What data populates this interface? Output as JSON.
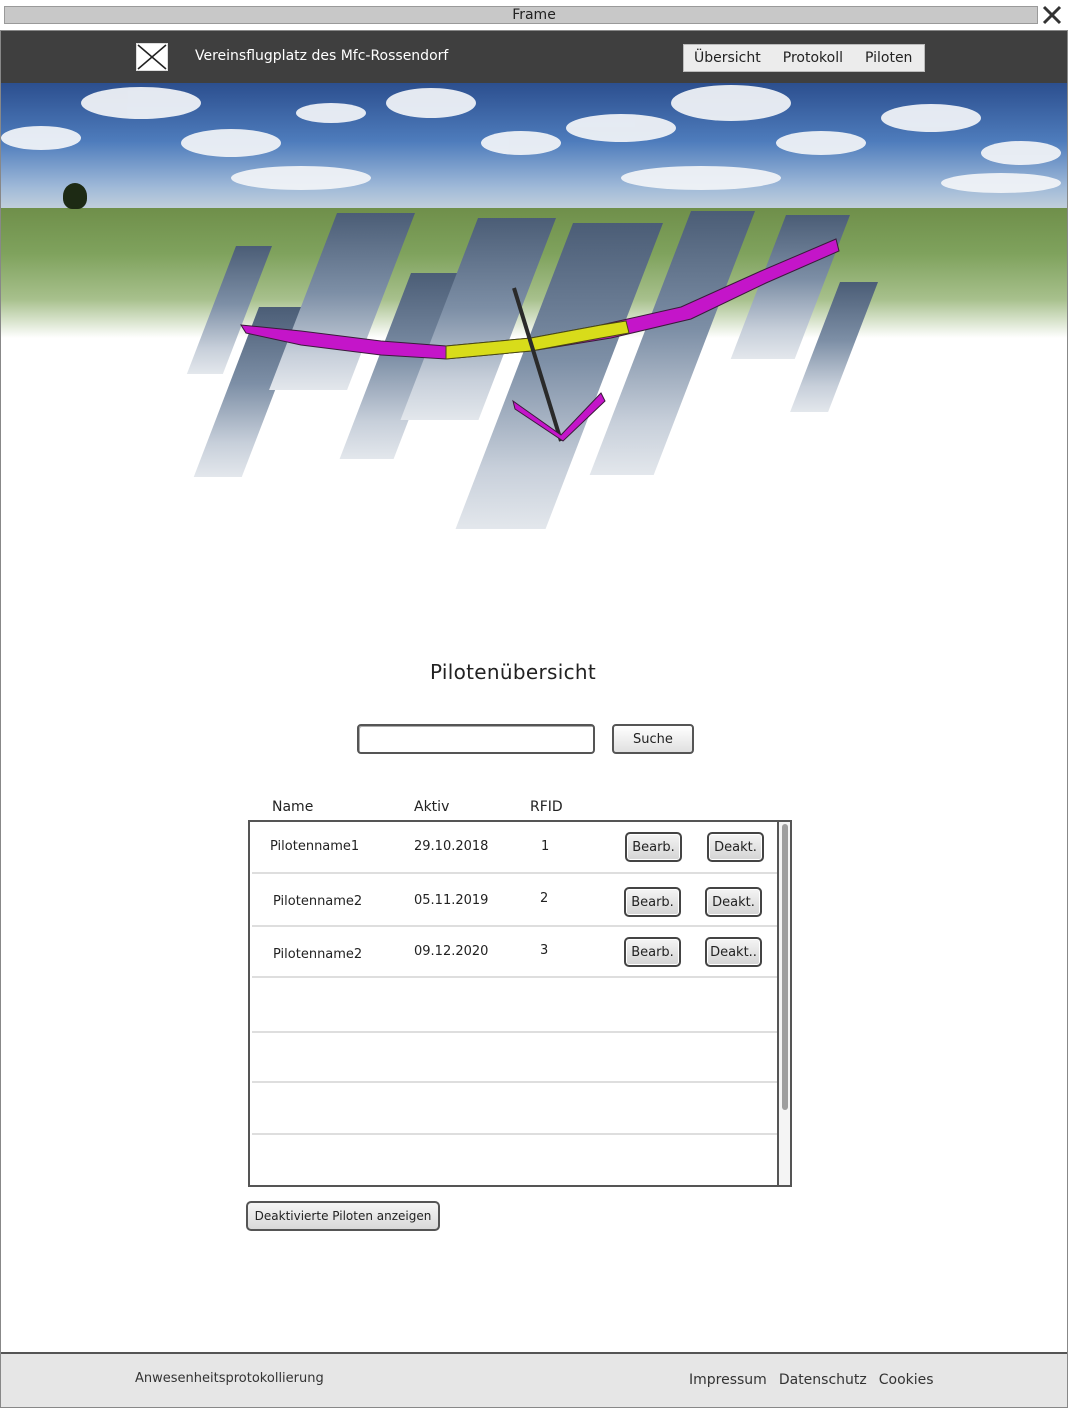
{
  "window": {
    "title": "Frame"
  },
  "header": {
    "site_title": "Vereinsflugplatz des Mfc-Rossendorf",
    "nav": [
      {
        "label": "Übersicht"
      },
      {
        "label": "Protokoll"
      },
      {
        "label": "Piloten"
      }
    ]
  },
  "main": {
    "title": "Pilotenübersicht",
    "search": {
      "value": "",
      "placeholder": "",
      "button_label": "Suche"
    },
    "table": {
      "columns": [
        "Name",
        "Aktiv",
        "RFID"
      ],
      "rows": [
        {
          "name": "Pilotenname1",
          "aktiv": "29.10.2018",
          "rfid": "1",
          "edit_label": "Bearb.",
          "deact_label": "Deakt."
        },
        {
          "name": "Pilotenname2",
          "aktiv": "05.11.2019",
          "rfid": "2",
          "edit_label": "Bearb.",
          "deact_label": "Deakt."
        },
        {
          "name": "Pilotenname2",
          "aktiv": "09.12.2020",
          "rfid": "3",
          "edit_label": "Bearb.",
          "deact_label": "Deakt.."
        }
      ]
    },
    "show_deactivated_label": "Deaktivierte Piloten anzeigen"
  },
  "footer": {
    "brand": "Anwesenheitsprotokollierung",
    "links": [
      {
        "label": "Impressum"
      },
      {
        "label": "Datenschutz"
      },
      {
        "label": "Cookies"
      }
    ]
  },
  "icons": {
    "logo": "image-placeholder-icon",
    "close": "close-icon"
  },
  "colors": {
    "header_bg": "#3f3f3f",
    "footer_bg": "#e6e6e6",
    "wing_magenta": "#c415c9",
    "wing_yellow": "#d8dc1a"
  }
}
